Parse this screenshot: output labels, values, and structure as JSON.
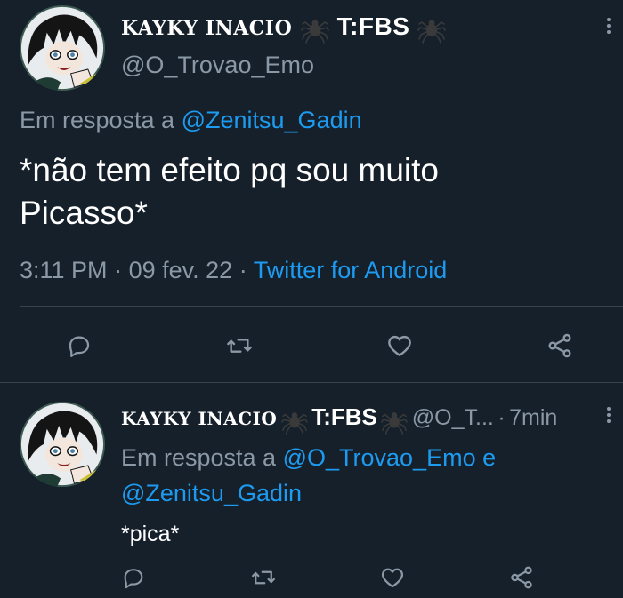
{
  "main_tweet": {
    "display_name": "KAYKY INACIO",
    "name_tag": "T:FBS",
    "handle": "@O_Trovao_Emo",
    "reply_prefix": "Em resposta a",
    "reply_to": "@Zenitsu_Gadin",
    "text_line1": "*não tem efeito pq sou muito",
    "text_line2": "Picasso*",
    "time": "3:11 PM",
    "date": "09 fev. 22",
    "separator": "·",
    "source": "Twitter for Android"
  },
  "reply_tweet": {
    "display_name": "KAYKY INACIO",
    "name_tag": "T:FBS",
    "handle": "@O_T...",
    "separator": "·",
    "age": "7min",
    "reply_prefix": "Em resposta a",
    "reply_to_1": "@O_Trovao_Emo",
    "reply_and": "e",
    "reply_to_2": "@Zenitsu_Gadin",
    "text": "*pica*"
  },
  "icons": {
    "reply": "reply-icon",
    "retweet": "retweet-icon",
    "like": "heart-icon",
    "share": "share-icon",
    "more": "more-vertical-icon",
    "spider": "spider-emoji-icon"
  },
  "colors": {
    "background": "#15202b",
    "text": "#ffffff",
    "muted": "#8b98a5",
    "link": "#1d9bf0",
    "divider": "#38444d"
  }
}
